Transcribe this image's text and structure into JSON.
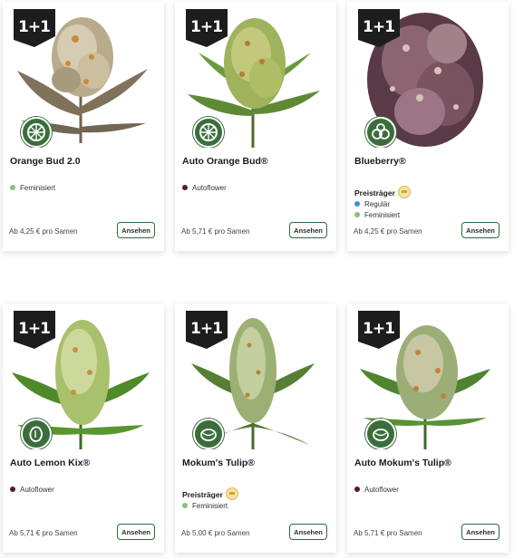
{
  "colors": {
    "brand_green": "#3b6e3c",
    "feminisiert_dot": "#8bbf7f",
    "autoflower_dot": "#5a1a1a",
    "regular_dot": "#3a95d1",
    "button_border": "#2e6b3a"
  },
  "products": [
    {
      "promo": "1+1",
      "name": "Orange Bud 2.0",
      "type_icon": "citrus-slice-icon",
      "award": null,
      "attributes": [
        {
          "label": "Feminisiert",
          "kind": "feminisiert"
        }
      ],
      "price": "Ab 4,25 € pro Samen",
      "button": "Ansehen"
    },
    {
      "promo": "1+1",
      "name": "Auto Orange Bud®",
      "type_icon": "citrus-slice-icon",
      "award": null,
      "attributes": [
        {
          "label": "Autoflower",
          "kind": "autoflower"
        }
      ],
      "price": "Ab 5,71 € pro Samen",
      "button": "Ansehen"
    },
    {
      "promo": "1+1",
      "name": "Blueberry®",
      "type_icon": "berries-icon",
      "award": "Preisträger",
      "attributes": [
        {
          "label": "Regulär",
          "kind": "regular"
        },
        {
          "label": "Feminisiert",
          "kind": "feminisiert"
        }
      ],
      "price": "Ab 4,25 € pro Samen",
      "button": "Ansehen"
    },
    {
      "promo": "1+1",
      "name": "Auto Lemon Kix®",
      "type_icon": "lemon-icon",
      "award": null,
      "attributes": [
        {
          "label": "Autoflower",
          "kind": "autoflower"
        }
      ],
      "price": "Ab 5,71 € pro Samen",
      "button": "Ansehen"
    },
    {
      "promo": "1+1",
      "name": "Mokum's Tulip®",
      "type_icon": "tulip-bulb-icon",
      "award": "Preisträger",
      "attributes": [
        {
          "label": "Feminisiert",
          "kind": "feminisiert"
        }
      ],
      "price": "Ab 5,00 € pro Samen",
      "button": "Ansehen"
    },
    {
      "promo": "1+1",
      "name": "Auto Mokum's Tulip®",
      "type_icon": "tulip-bulb-icon",
      "award": null,
      "attributes": [
        {
          "label": "Autoflower",
          "kind": "autoflower"
        }
      ],
      "price": "Ab 5,71 € pro Samen",
      "button": "Ansehen"
    }
  ]
}
